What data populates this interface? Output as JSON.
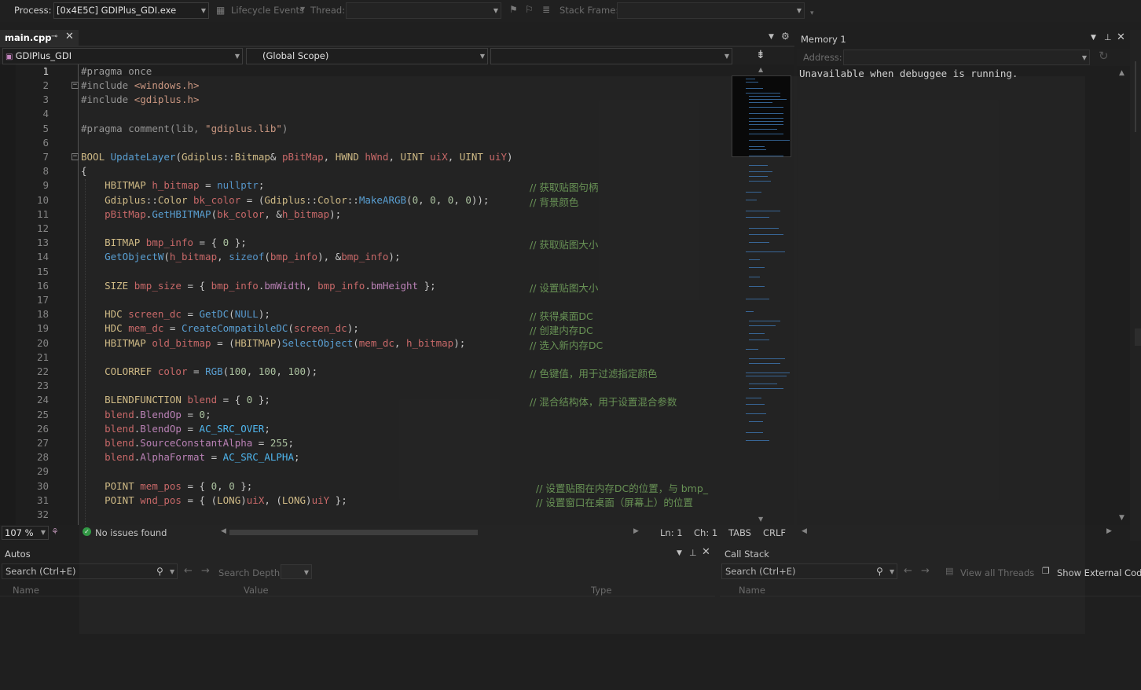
{
  "toolbar": {
    "process_label": "Process:",
    "process_value": "[0x4E5C] GDIPlus_GDI.exe",
    "lifecycle_label": "Lifecycle Events",
    "thread_label": "Thread:",
    "stack_frame_label": "Stack Frame:"
  },
  "editor_tab": {
    "filename": "main.cpp"
  },
  "navbar": {
    "project": "GDIPlus_GDI",
    "scope": "(Global Scope)"
  },
  "code_lines": [
    "1",
    "2",
    "3",
    "4",
    "5",
    "6",
    "7",
    "8",
    "9",
    "10",
    "11",
    "12",
    "13",
    "14",
    "15",
    "16",
    "17",
    "18",
    "19",
    "20",
    "21",
    "22",
    "23",
    "24",
    "25",
    "26",
    "27",
    "28",
    "29",
    "30",
    "31",
    "32"
  ],
  "code": {
    "l1a": "#pragma",
    "l1b": " once",
    "l2a": "#include",
    "l2b": " <windows.h>",
    "l3a": "#include",
    "l3b": " <gdiplus.h>",
    "l5a": "#pragma",
    "l5b": " comment(lib, ",
    "l5c": "\"gdiplus.lib\"",
    "l5d": ")",
    "l7": {
      "t1": "BOOL",
      "f": "UpdateLayer",
      "p1": "(",
      "ns": "Gdiplus",
      "c1": "::",
      "t2": "Bitmap",
      "amp": "& ",
      "v1": "pBitMap",
      "cm1": ", ",
      "t3": "HWND",
      "v2": "hWnd",
      "cm2": ", ",
      "t4": "UINT",
      "v3": "uiX",
      "cm3": ", ",
      "t5": "UINT",
      "v4": "uiY",
      "p2": ")"
    },
    "l8": "{",
    "l9": {
      "t": "HBITMAP",
      "v": "h_bitmap",
      "eq": " = ",
      "k": "nullptr",
      "s": ";",
      "c": "// 获取贴图句柄"
    },
    "l10": {
      "ns": "Gdiplus",
      "c1": "::",
      "t": "Color",
      "v": "bk_color",
      "eq": " = (",
      "ns2": "Gdiplus",
      "c2": "::",
      "t2": "Color",
      "c3": "::",
      "f": "MakeARGB",
      "a": "(",
      "n1": "0",
      "n2": "0",
      "n3": "0",
      "n4": "0",
      "e": "));",
      "c": "// 背景颜色"
    },
    "l11": {
      "v": "pBitMap",
      "d": ".",
      "f": "GetHBITMAP",
      "a": "(",
      "v2": "bk_color",
      "m": ", &",
      "v3": "h_bitmap",
      "e": ");"
    },
    "l13": {
      "t": "BITMAP",
      "v": "bmp_info",
      "eq": " = { ",
      "n": "0",
      "e": " };",
      "c": "// 获取贴图大小"
    },
    "l14": {
      "f": "GetObjectW",
      "a": "(",
      "v": "h_bitmap",
      "m": ", ",
      "k": "sizeof",
      "a2": "(",
      "v2": "bmp_info",
      "m2": "), &",
      "v3": "bmp_info",
      "e": ");"
    },
    "l16": {
      "t": "SIZE",
      "v": "bmp_size",
      "eq": " = { ",
      "v2": "bmp_info",
      "d": ".",
      "m1": "bmWidth",
      "cm": ", ",
      "v3": "bmp_info",
      "d2": ".",
      "m2": "bmHeight",
      "e": " };",
      "c": "// 设置贴图大小"
    },
    "l18": {
      "t": "HDC",
      "v": "screen_dc",
      "eq": " = ",
      "f": "GetDC",
      "a": "(",
      "k": "NULL",
      "e": ");",
      "c": "// 获得桌面DC"
    },
    "l19": {
      "t": "HDC",
      "v": "mem_dc",
      "eq": " = ",
      "f": "CreateCompatibleDC",
      "a": "(",
      "v2": "screen_dc",
      "e": ");",
      "c": "// 创建内存DC"
    },
    "l20": {
      "t": "HBITMAP",
      "v": "old_bitmap",
      "eq": " = (",
      "t2": "HBITMAP",
      "p": ")",
      "f": "SelectObject",
      "a": "(",
      "v2": "mem_dc",
      "cm": ", ",
      "v3": "h_bitmap",
      "e": ");",
      "c": "// 选入新内存DC"
    },
    "l22": {
      "t": "COLORREF",
      "v": "color",
      "eq": " = ",
      "f": "RGB",
      "a": "(",
      "n1": "100",
      "n2": "100",
      "n3": "100",
      "e": ");",
      "c": "// 色键值，用于过滤指定颜色"
    },
    "l24": {
      "t": "BLENDFUNCTION",
      "v": "blend",
      "eq": " = { ",
      "n": "0",
      "e": " };",
      "c": "// 混合结构体，用于设置混合参数"
    },
    "l25": {
      "v": "blend",
      "d": ".",
      "m": "BlendOp",
      "eq": " = ",
      "n": "0",
      "e": ";"
    },
    "l26": {
      "v": "blend",
      "d": ".",
      "m": "BlendOp",
      "eq": " = ",
      "k": "AC_SRC_OVER",
      "e": ";"
    },
    "l27": {
      "v": "blend",
      "d": ".",
      "m": "SourceConstantAlpha",
      "eq": " = ",
      "n": "255",
      "e": ";"
    },
    "l28": {
      "v": "blend",
      "d": ".",
      "m": "AlphaFormat",
      "eq": " = ",
      "k": "AC_SRC_ALPHA",
      "e": ";"
    },
    "l30": {
      "t": "POINT",
      "v": "mem_pos",
      "eq": " = { ",
      "n1": "0",
      "cm": ", ",
      "n2": "0",
      "e": " };",
      "c": "// 设置贴图在内存DC的位置，与 bmp_"
    },
    "l31": {
      "t": "POINT",
      "v": "wnd_pos",
      "eq": " = { (",
      "t2": "LONG",
      "p": ")",
      "v2": "uiX",
      "cm": ", (",
      "t3": "LONG",
      "p2": ")",
      "v3": "uiY",
      "e": " };",
      "c": "// 设置窗口在桌面（屏幕上）的位置"
    }
  },
  "status": {
    "zoom": "107 %",
    "issues": "No issues found",
    "ln": "Ln: 1",
    "ch": "Ch: 1",
    "tabs": "TABS",
    "eol": "CRLF"
  },
  "memory": {
    "title": "Memory 1",
    "address_label": "Address:",
    "message": "Unavailable when debuggee is running."
  },
  "autos": {
    "title": "Autos",
    "search_placeholder": "Search (Ctrl+E)",
    "search_depth": "Search Depth:",
    "columns": [
      "Name",
      "Value",
      "Type"
    ]
  },
  "callstack": {
    "title": "Call Stack",
    "search_placeholder": "Search (Ctrl+E)",
    "view_all_threads": "View all Threads",
    "show_external": "Show External Code",
    "columns": [
      "Name"
    ]
  },
  "colors": {
    "background": "#1e1e1e",
    "keyword": "#569cd6",
    "type": "#dcc58b",
    "comment": "#6a9955",
    "param": "#d46a6a"
  }
}
